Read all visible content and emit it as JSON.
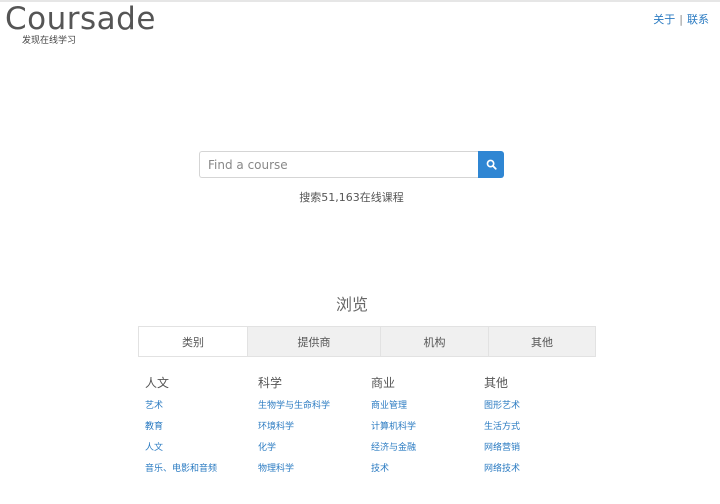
{
  "header": {
    "logo_title": "Coursade",
    "tagline": "发现在线学习",
    "links": [
      {
        "label": "关于"
      },
      {
        "label": "联系"
      }
    ],
    "separator": "|"
  },
  "search": {
    "placeholder": "Find a course",
    "button_icon": "search-icon",
    "count_text": "搜索51,163在线课程"
  },
  "browse": {
    "title": "浏览",
    "tabs": [
      {
        "label": "类别",
        "active": true
      },
      {
        "label": "提供商",
        "active": false
      },
      {
        "label": "机构",
        "active": false
      },
      {
        "label": "其他",
        "active": false
      }
    ],
    "columns": [
      {
        "title": "人文",
        "items": [
          "艺术",
          "教育",
          "人文",
          "音乐、电影和音频"
        ]
      },
      {
        "title": "科学",
        "items": [
          "生物学与生命科学",
          "环境科学",
          "化学",
          "物理科学"
        ]
      },
      {
        "title": "商业",
        "items": [
          "商业管理",
          "计算机科学",
          "经济与金融",
          "技术"
        ]
      },
      {
        "title": "其他",
        "items": [
          "图形艺术",
          "生活方式",
          "网络营销",
          "网络技术"
        ]
      }
    ]
  },
  "colors": {
    "accent": "#2f86d3",
    "link": "#2b7bc2",
    "tab_bg": "#f0f0f0"
  }
}
